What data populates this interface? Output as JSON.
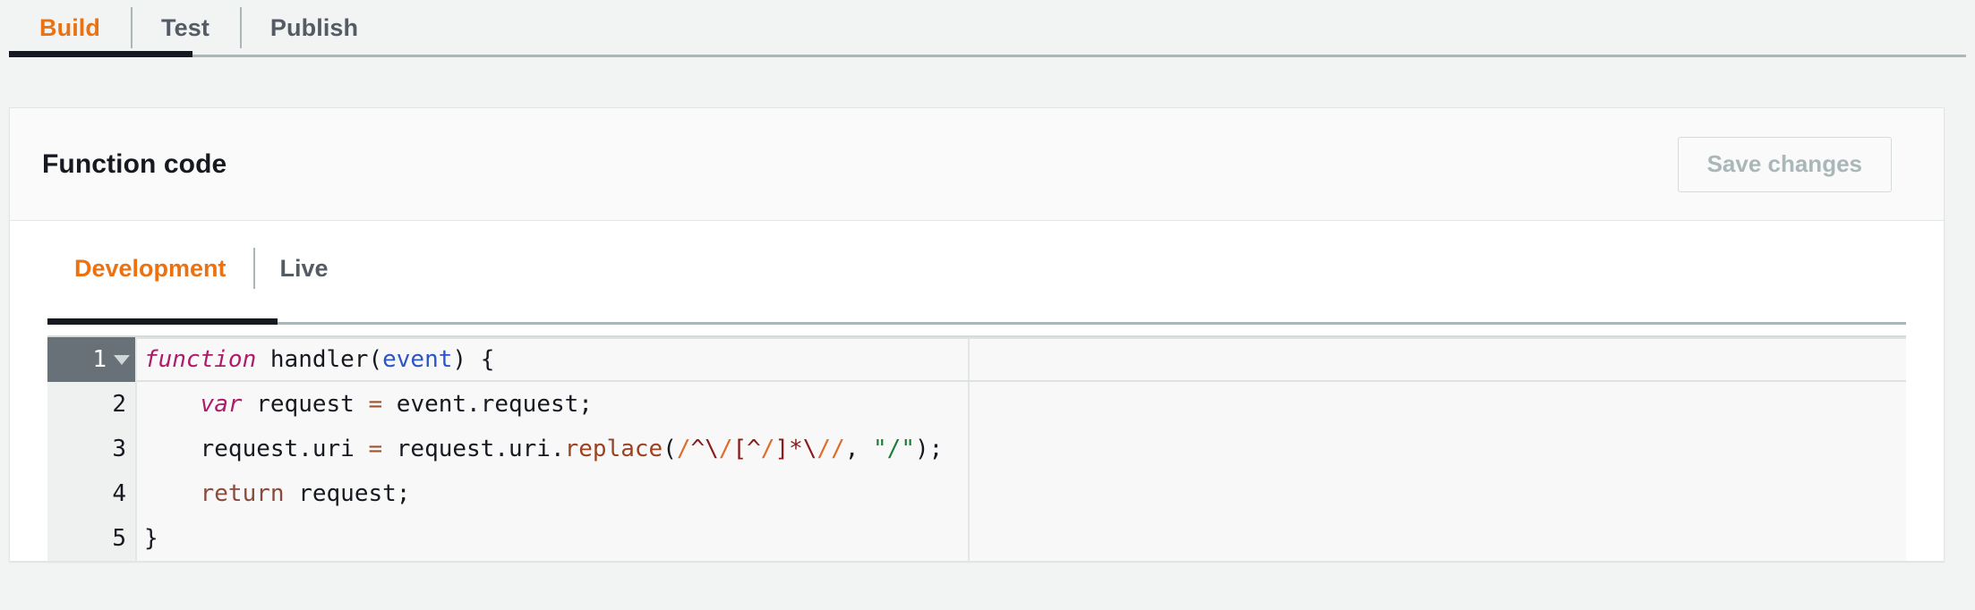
{
  "top_tabs": [
    {
      "label": "Build",
      "active": true
    },
    {
      "label": "Test",
      "active": false
    },
    {
      "label": "Publish",
      "active": false
    }
  ],
  "card": {
    "title": "Function code",
    "save_label": "Save changes",
    "save_disabled": true
  },
  "inner_tabs": [
    {
      "label": "Development",
      "active": true
    },
    {
      "label": "Live",
      "active": false
    }
  ],
  "editor": {
    "active_line": 1,
    "fold_icon": "chevron-down-icon",
    "line_numbers": [
      "1",
      "2",
      "3",
      "4",
      "5"
    ],
    "lines": [
      {
        "number": "1",
        "tokens": [
          {
            "t": "function",
            "c": "tok-keyword"
          },
          {
            "t": " handler(",
            "c": "tok-plain"
          },
          {
            "t": "event",
            "c": "tok-param"
          },
          {
            "t": ") {",
            "c": "tok-plain"
          }
        ]
      },
      {
        "number": "2",
        "tokens": [
          {
            "t": "    ",
            "c": "tok-plain"
          },
          {
            "t": "var",
            "c": "tok-keyword"
          },
          {
            "t": " request ",
            "c": "tok-plain"
          },
          {
            "t": "=",
            "c": "tok-op"
          },
          {
            "t": " event.request;",
            "c": "tok-plain"
          }
        ]
      },
      {
        "number": "3",
        "tokens": [
          {
            "t": "    request.uri ",
            "c": "tok-plain"
          },
          {
            "t": "=",
            "c": "tok-op"
          },
          {
            "t": " request.uri.",
            "c": "tok-plain"
          },
          {
            "t": "replace",
            "c": "tok-func"
          },
          {
            "t": "(",
            "c": "tok-plain"
          },
          {
            "t": "/",
            "c": "tok-regex-d"
          },
          {
            "t": "^",
            "c": "tok-regex-b"
          },
          {
            "t": "\\",
            "c": "tok-regex-b"
          },
          {
            "t": "/",
            "c": "tok-regex-d"
          },
          {
            "t": "[^",
            "c": "tok-regex-b"
          },
          {
            "t": "/",
            "c": "tok-regex-d"
          },
          {
            "t": "]*",
            "c": "tok-regex-b"
          },
          {
            "t": "\\",
            "c": "tok-regex-b"
          },
          {
            "t": "/",
            "c": "tok-regex-d"
          },
          {
            "t": "/",
            "c": "tok-regex-d"
          },
          {
            "t": ", ",
            "c": "tok-plain"
          },
          {
            "t": "\"/\"",
            "c": "tok-string"
          },
          {
            "t": ");",
            "c": "tok-plain"
          }
        ]
      },
      {
        "number": "4",
        "tokens": [
          {
            "t": "    ",
            "c": "tok-plain"
          },
          {
            "t": "return",
            "c": "tok-return"
          },
          {
            "t": " request;",
            "c": "tok-plain"
          }
        ]
      },
      {
        "number": "5",
        "tokens": [
          {
            "t": "}",
            "c": "tok-plain"
          }
        ]
      }
    ],
    "code_text": "function handler(event) {\n    var request = event.request;\n    request.uri = request.uri.replace(/^\\/[^/]*\\//, \"/\");\n    return request;\n}"
  },
  "colors": {
    "accent_orange": "#ec7211",
    "active_underline": "#16191f",
    "page_bg": "#f2f3f3",
    "card_bg": "#fafafa",
    "editor_bg": "#f8f8f8",
    "gutter_bg": "#eff1f1",
    "gutter_active_bg": "#687078",
    "disabled_text": "#aab7b8",
    "border": "#e3e6e6",
    "tab_text": "#545b64"
  }
}
